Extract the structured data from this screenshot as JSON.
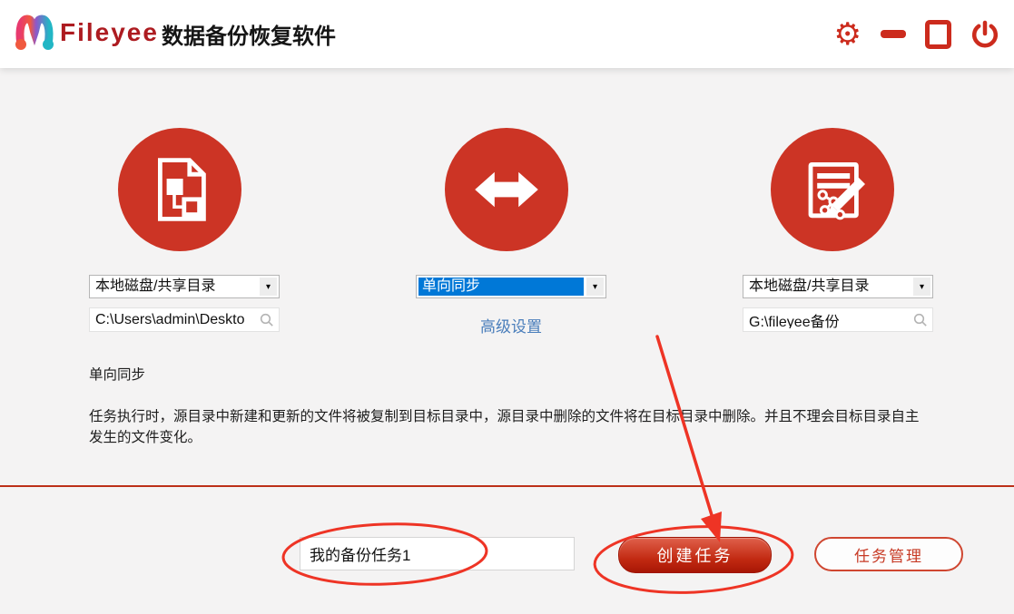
{
  "header": {
    "brand": "Fileyee",
    "app_title": "数据备份恢复软件"
  },
  "icons": {
    "gear": "⚙",
    "caret": "▾"
  },
  "source": {
    "type_selected": "本地磁盘/共享目录",
    "path": "C:\\Users\\admin\\Deskto"
  },
  "sync": {
    "mode_selected": "单向同步",
    "advanced_link": "高级设置"
  },
  "target": {
    "type_selected": "本地磁盘/共享目录",
    "path": "G:\\fileyee备份"
  },
  "description": {
    "title": "单向同步",
    "body": "任务执行时，源目录中新建和更新的文件将被复制到目标目录中，源目录中删除的文件将在目标目录中删除。并且不理会目标目录自主发生的文件变化。"
  },
  "footer": {
    "task_name": "我的备份任务1",
    "create_label": "创建任务",
    "manage_label": "任务管理"
  },
  "colors": {
    "accent_red": "#cc3425",
    "brand_red": "#ad1b20",
    "select_blue": "#0078d7",
    "link_blue": "#4a7ebb",
    "annotation_red": "#ee3425",
    "divider_red": "#bc3018"
  }
}
